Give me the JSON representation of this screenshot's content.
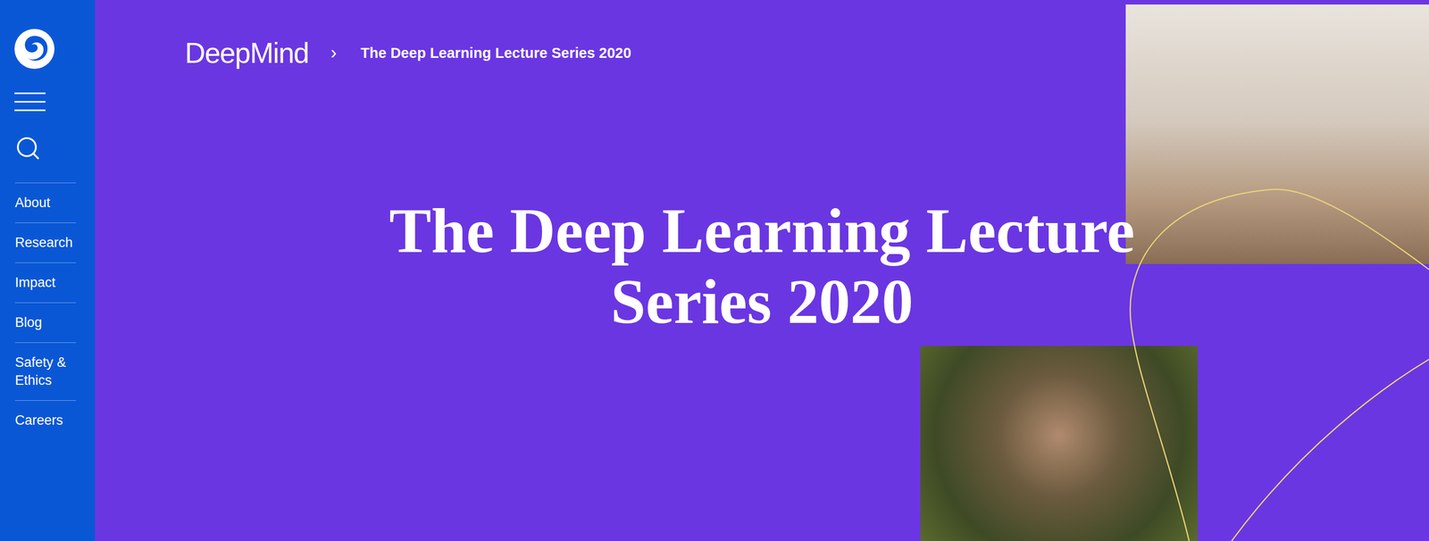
{
  "sidebar": {
    "items": [
      {
        "label": "About"
      },
      {
        "label": "Research"
      },
      {
        "label": "Impact"
      },
      {
        "label": "Blog"
      },
      {
        "label": "Safety & Ethics"
      },
      {
        "label": "Careers"
      }
    ]
  },
  "breadcrumb": {
    "brand": "DeepMind",
    "separator": "›",
    "current": "The Deep Learning Lecture Series 2020"
  },
  "hero": {
    "title": "The Deep Learning Lecture Series 2020"
  }
}
